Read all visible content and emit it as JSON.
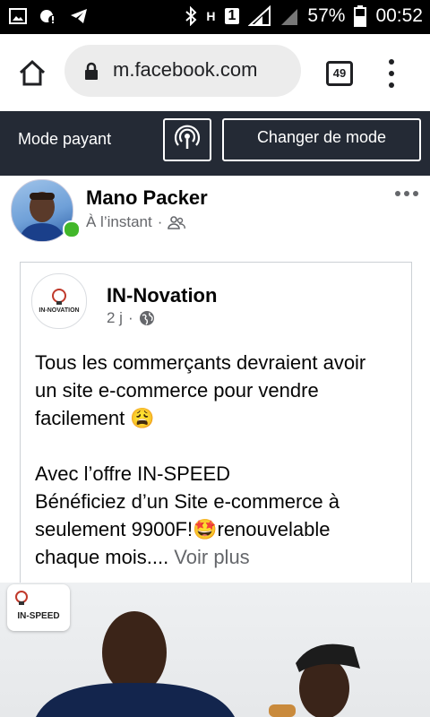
{
  "status_bar": {
    "battery": "57%",
    "time": "00:52",
    "sim_label": "1",
    "data_label": "H"
  },
  "browser": {
    "url": "m.facebook.com",
    "tab_count": "49"
  },
  "mode_bar": {
    "label": "Mode payant",
    "change_button": "Changer de mode"
  },
  "post": {
    "author": "Mano Packer",
    "time": "À l’instant",
    "shared": {
      "page_name": "IN-Novation",
      "time": "2 j",
      "paragraph1_line1": "Tous les commerçants devraient avoir",
      "paragraph1_line2": "un site e-commerce pour vendre",
      "paragraph1_line3": "facilement 😩",
      "paragraph2_line1": "Avec l’offre IN-SPEED",
      "paragraph2_line2": "Bénéficiez d’un Site e-commerce à",
      "paragraph2_line3": "seulement 9900F!🤩renouvelable",
      "paragraph2_line4": "chaque mois....",
      "see_more": " Voir plus"
    }
  },
  "colors": {
    "mode_bar_bg": "#242a35",
    "online": "#42b72a",
    "meta_text": "#65676b"
  },
  "icons": [
    "gallery-icon",
    "notification-icon",
    "telegram-icon",
    "bluetooth-icon",
    "signal-icon",
    "battery-icon",
    "home-icon",
    "lock-icon",
    "tabs-icon",
    "menu-icon",
    "broadcast-icon",
    "friends-icon",
    "globe-icon",
    "more-icon"
  ]
}
